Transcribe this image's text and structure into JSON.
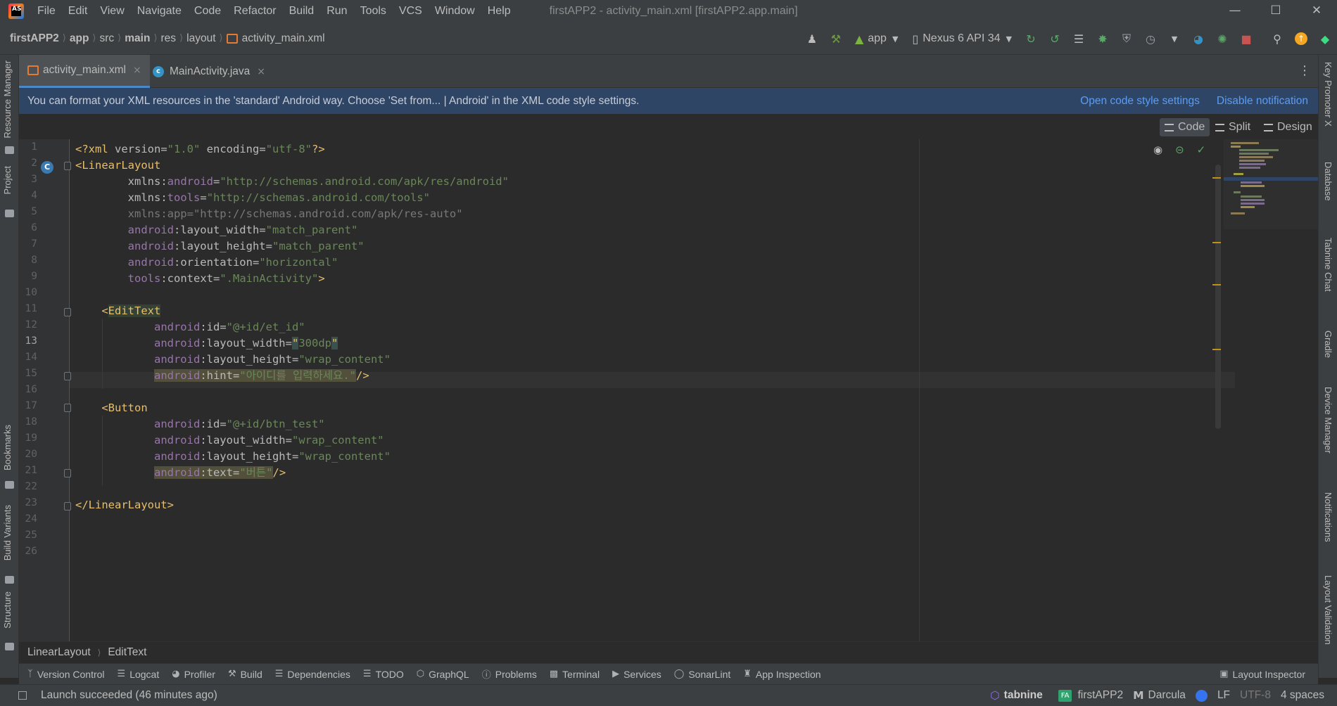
{
  "menu": {
    "items": [
      "File",
      "Edit",
      "View",
      "Navigate",
      "Code",
      "Refactor",
      "Build",
      "Run",
      "Tools",
      "VCS",
      "Window",
      "Help"
    ],
    "window_title": "firstAPP2 - activity_main.xml [firstAPP2.app.main]"
  },
  "nav": {
    "crumbs": [
      "firstAPP2",
      "app",
      "src",
      "main",
      "res",
      "layout",
      "activity_main.xml"
    ],
    "run_config": "app",
    "device": "Nexus 6 API 34"
  },
  "left_tools": [
    "Resource Manager",
    "Project",
    "Bookmarks",
    "Build Variants",
    "Structure"
  ],
  "right_tools": [
    "Key Promoter X",
    "Database",
    "Tabnine Chat",
    "Gradle",
    "Device Manager",
    "Notifications",
    "Layout Validation"
  ],
  "tabs": [
    {
      "label": "activity_main.xml",
      "close": "×"
    },
    {
      "label": "MainActivity.java",
      "close": "×"
    }
  ],
  "banner": {
    "text": "You can format your XML resources in the 'standard' Android way. Choose 'Set from... | Android' in the XML code style settings.",
    "link1": "Open code style settings",
    "link2": "Disable notification"
  },
  "view_modes": {
    "code": "Code",
    "split": "Split",
    "design": "Design"
  },
  "editor": {
    "line_numbers": [
      "1",
      "2",
      "3",
      "4",
      "5",
      "6",
      "7",
      "8",
      "9",
      "10",
      "11",
      "12",
      "13",
      "14",
      "15",
      "16",
      "17",
      "18",
      "19",
      "20",
      "21",
      "22",
      "23",
      "24",
      "25",
      "26"
    ],
    "current_line": 13
  },
  "breadcrumb_bottom": [
    "LinearLayout",
    "EditText"
  ],
  "tool_windows": [
    "Version Control",
    "Logcat",
    "Profiler",
    "Build",
    "Dependencies",
    "TODO",
    "GraphQL",
    "Problems",
    "Terminal",
    "Services",
    "SonarLint",
    "App Inspection"
  ],
  "layout_inspector": "Layout Inspector",
  "status": {
    "message": "Launch succeeded (46 minutes ago)",
    "tabnine": "tabnine",
    "project_badge": "FA",
    "project": "firstAPP2",
    "theme": "Darcula",
    "line_sep": "LF",
    "encoding": "UTF-8",
    "indent": "4 spaces"
  },
  "colors": {
    "tag": "#e8bf6a",
    "attr_ns": "#9876aa",
    "attr": "#bababa",
    "value": "#6a8759",
    "banner_link": "#589df6",
    "accent": "#4a88c7"
  }
}
